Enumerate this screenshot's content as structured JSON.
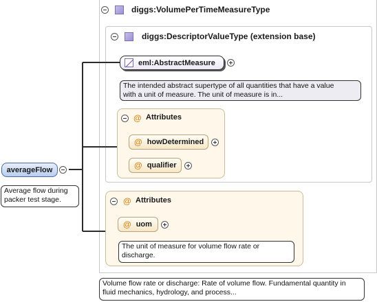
{
  "root": {
    "name": "averageFlow",
    "doc": [
      "Average flow during",
      "packer test stage."
    ]
  },
  "type": {
    "name": "diggs:VolumePerTimeMeasureType",
    "doc": [
      "Volume flow rate or discharge: Rate of volume flow. Fundamental quantity in",
      "fluid mechanics, hydrology, and process..."
    ]
  },
  "base": {
    "name": "diggs:DescriptorValueType (extension base)"
  },
  "abstract_measure": {
    "name": "eml:AbstractMeasure",
    "doc": [
      "The intended abstract supertype of all quantities that have a value",
      "with a unit of measure. The unit of measure is in..."
    ]
  },
  "attributes_inner": {
    "label": "Attributes",
    "at": "@",
    "items": [
      {
        "name": "howDetermined"
      },
      {
        "name": "qualifier"
      }
    ]
  },
  "attributes_outer": {
    "label": "Attributes",
    "at": "@",
    "item": {
      "name": "uom"
    },
    "doc": [
      "The unit of measure for volume flow rate or",
      "discharge."
    ]
  }
}
